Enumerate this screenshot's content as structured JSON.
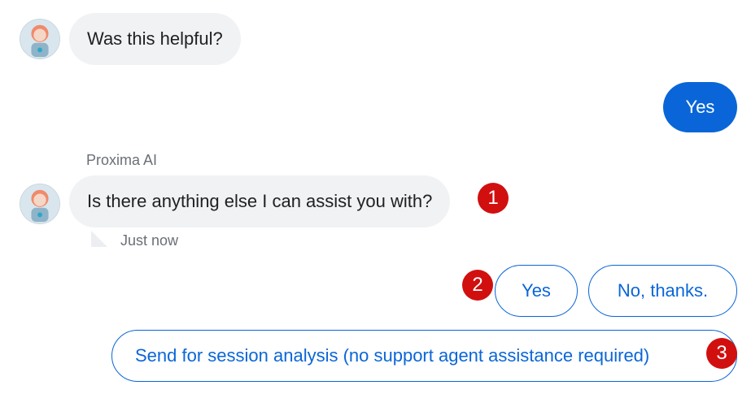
{
  "conversation": {
    "bot_message_1": "Was this helpful?",
    "user_reply": "Yes",
    "sender_name": "Proxima AI",
    "bot_message_2": "Is there anything else I can assist you with?",
    "timestamp": "Just now"
  },
  "quick_replies": {
    "yes": "Yes",
    "no": "No, thanks.",
    "session_analysis": "Send for session analysis (no support agent assistance required)"
  },
  "markers": [
    "1",
    "2",
    "3"
  ],
  "colors": {
    "accent": "#0a66d8",
    "bot_bubble": "#f1f2f4",
    "marker": "#d10f0f"
  },
  "icons": {
    "avatar": "robot-avatar-icon"
  }
}
